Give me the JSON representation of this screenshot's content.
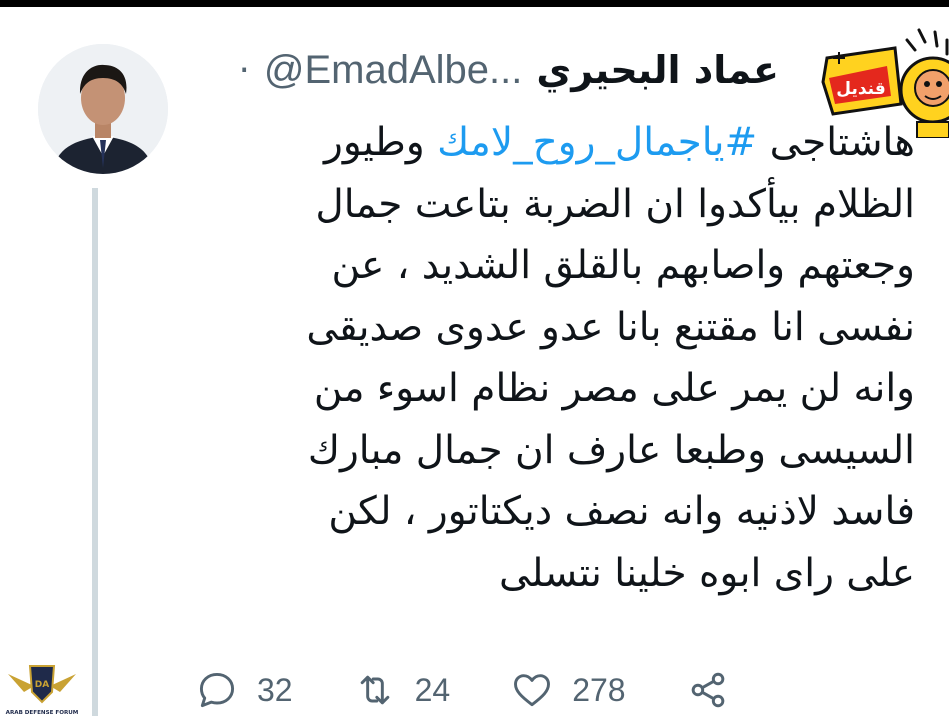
{
  "tweet": {
    "display_name": "عماد البحيري",
    "handle": "@EmadAlbe...",
    "separator": "·",
    "text_lines": [
      [
        "هاشتاجى ",
        "#ياجمال_روح_لامك",
        " وطيور"
      ],
      [
        "الظلام بيأكدوا ان الضربة بتاعت جمال"
      ],
      [
        "وجعتهم واصابهم بالقلق الشديد ، عن"
      ],
      [
        "نفسى انا مقتنع بانا عدو عدوى صديقى"
      ],
      [
        "وانه لن يمر على مصر نظام اسوء من"
      ],
      [
        "السيسى وطبعا عارف ان جمال مبارك"
      ],
      [
        "فاسد لاذنيه وانه نصف ديكتاتور ، لكن"
      ],
      [
        "على راى ابوه خلينا نتسلى"
      ]
    ],
    "line1": {
      "prefix": "هاشتاجى ",
      "hashtag": "#ياجمال_روح_لامك",
      "suffix": " وطيور"
    },
    "line2": "الظلام بيأكدوا ان الضربة بتاعت جمال",
    "line3": "وجعتهم واصابهم بالقلق الشديد ، عن",
    "line4": "نفسى انا مقتنع بانا عدو عدوى صديقى",
    "line5": "وانه لن يمر على مصر نظام اسوء من",
    "line6": "السيسى وطبعا عارف ان جمال مبارك",
    "line7": "فاسد لاذنيه وانه نصف ديكتاتور ، لكن",
    "line8": "على راى ابوه خلينا نتسلى"
  },
  "stats": {
    "replies": "32",
    "retweets": "24",
    "likes": "278"
  },
  "badge": {
    "text": "قنديل"
  },
  "forum_logo": {
    "text": "ARAB DEFENSE FORUM"
  },
  "colors": {
    "hashtag": "#1d9bf0",
    "secondary_text": "#536471",
    "badge_yellow": "#ffd21f"
  },
  "icons": [
    "reply-icon",
    "retweet-icon",
    "like-icon",
    "share-icon"
  ]
}
